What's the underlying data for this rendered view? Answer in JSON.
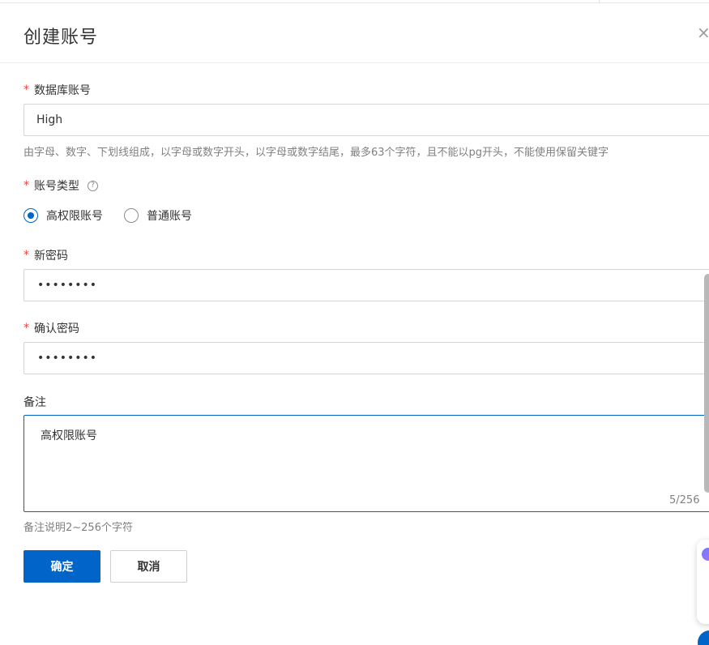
{
  "dialog": {
    "title": "创建账号",
    "close_glyph": "×"
  },
  "form": {
    "account_name": {
      "required_mark": "*",
      "label": "数据库账号",
      "value": "High",
      "hint": "由字母、数字、下划线组成，以字母或数字开头，以字母或数字结尾，最多63个字符，且不能以pg开头，不能使用保留关键字"
    },
    "account_type": {
      "required_mark": "*",
      "label": "账号类型",
      "help_glyph": "?",
      "options": [
        {
          "label": "高权限账号",
          "checked": true
        },
        {
          "label": "普通账号",
          "checked": false
        }
      ]
    },
    "new_password": {
      "required_mark": "*",
      "label": "新密码",
      "value": "••••••••"
    },
    "confirm_password": {
      "required_mark": "*",
      "label": "确认密码",
      "value": "••••••••"
    },
    "remark": {
      "label": "备注",
      "value": "高权限账号",
      "counter": "5/256",
      "hint": "备注说明2~256个字符"
    }
  },
  "actions": {
    "confirm_label": "确定",
    "cancel_label": "取消"
  },
  "colors": {
    "primary": "#0064c8",
    "required": "#e54545"
  }
}
